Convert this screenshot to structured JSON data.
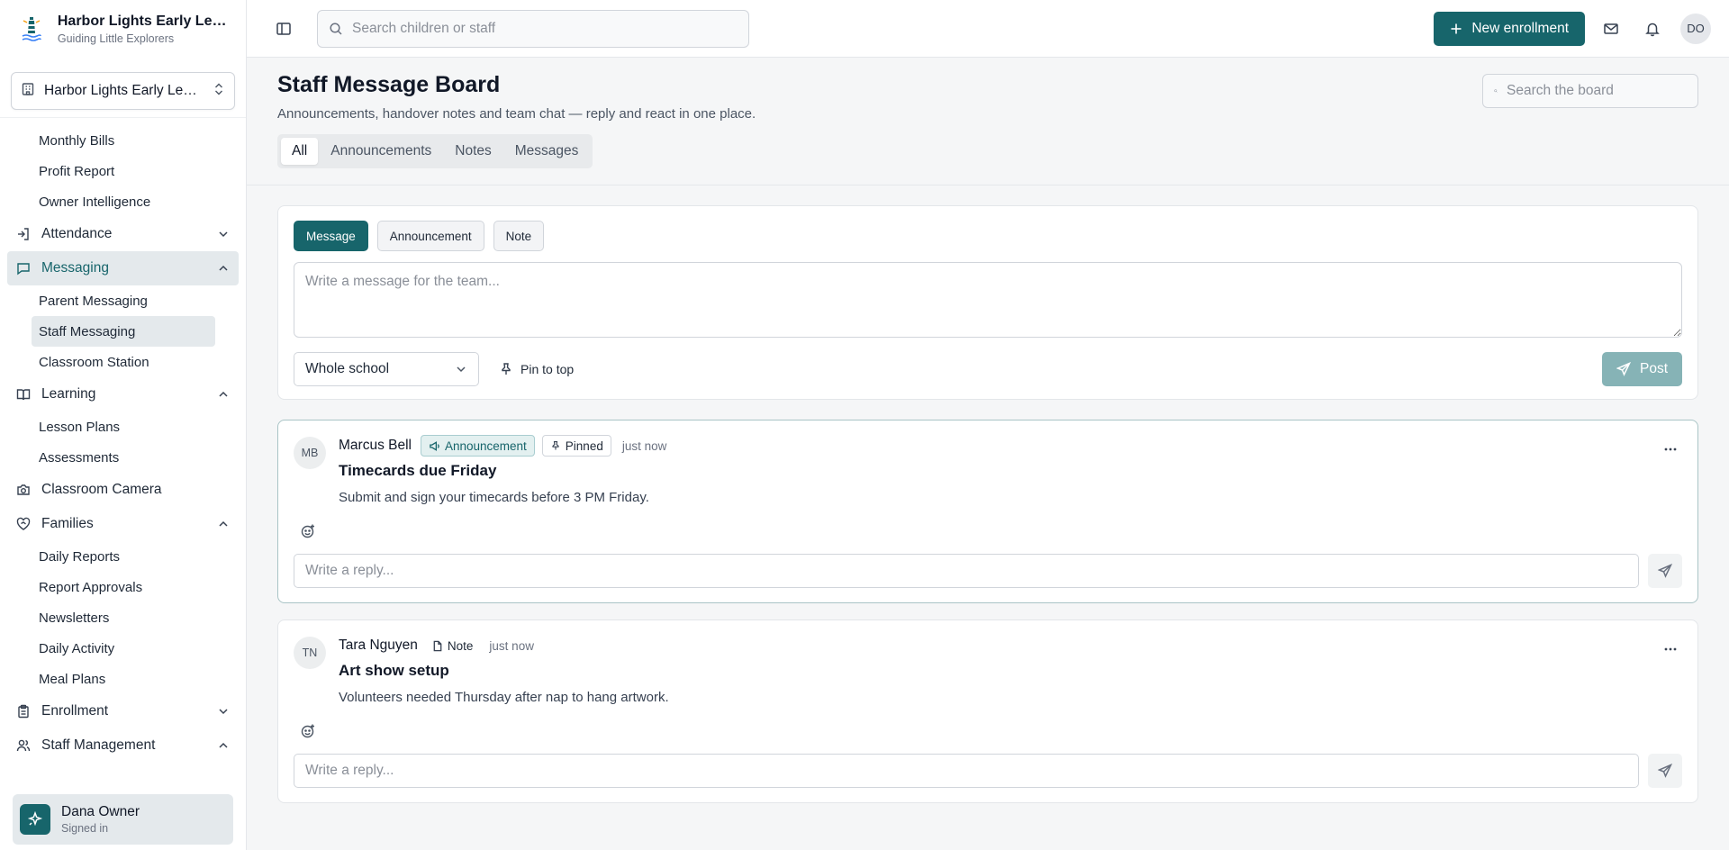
{
  "brand": {
    "title": "Harbor Lights Early Learn...",
    "subtitle": "Guiding Little Explorers"
  },
  "school_select": {
    "label": "Harbor Lights Early Lear..."
  },
  "sidebar": {
    "finance_items": [
      "Monthly Bills",
      "Profit Report",
      "Owner Intelligence"
    ],
    "attendance": "Attendance",
    "messaging": "Messaging",
    "messaging_items": [
      "Parent Messaging",
      "Staff Messaging",
      "Classroom Station"
    ],
    "learning": "Learning",
    "learning_items": [
      "Lesson Plans",
      "Assessments"
    ],
    "camera": "Classroom Camera",
    "families": "Families",
    "families_items": [
      "Daily Reports",
      "Report Approvals",
      "Newsletters",
      "Daily Activity",
      "Meal Plans"
    ],
    "enrollment": "Enrollment",
    "staff": "Staff Management"
  },
  "user": {
    "name": "Dana Owner",
    "status": "Signed in"
  },
  "topbar": {
    "search_placeholder": "Search children or staff",
    "new_enrollment": "New enrollment",
    "avatar_initials": "DO"
  },
  "page": {
    "title": "Staff Message Board",
    "description": "Announcements, handover notes and team chat — reply and react in one place.",
    "search_placeholder": "Search the board",
    "tabs": [
      "All",
      "Announcements",
      "Notes",
      "Messages"
    ]
  },
  "composer": {
    "types": [
      "Message",
      "Announcement",
      "Note"
    ],
    "placeholder": "Write a message for the team...",
    "audience": "Whole school",
    "pin_label": "Pin to top",
    "post_label": "Post"
  },
  "posts": [
    {
      "initials": "MB",
      "author": "Marcus Bell",
      "type_badge": "Announcement",
      "pinned_badge": "Pinned",
      "time": "just now",
      "title": "Timecards due Friday",
      "text": "Submit and sign your timecards before 3 PM Friday.",
      "reply_placeholder": "Write a reply..."
    },
    {
      "initials": "TN",
      "author": "Tara Nguyen",
      "type_badge": "Note",
      "time": "just now",
      "title": "Art show setup",
      "text": "Volunteers needed Thursday after nap to hang artwork.",
      "reply_placeholder": "Write a reply..."
    }
  ],
  "colors": {
    "primary": "#17656b",
    "primary_disabled": "#86b3b6",
    "active_bg": "#e4e9ec"
  }
}
